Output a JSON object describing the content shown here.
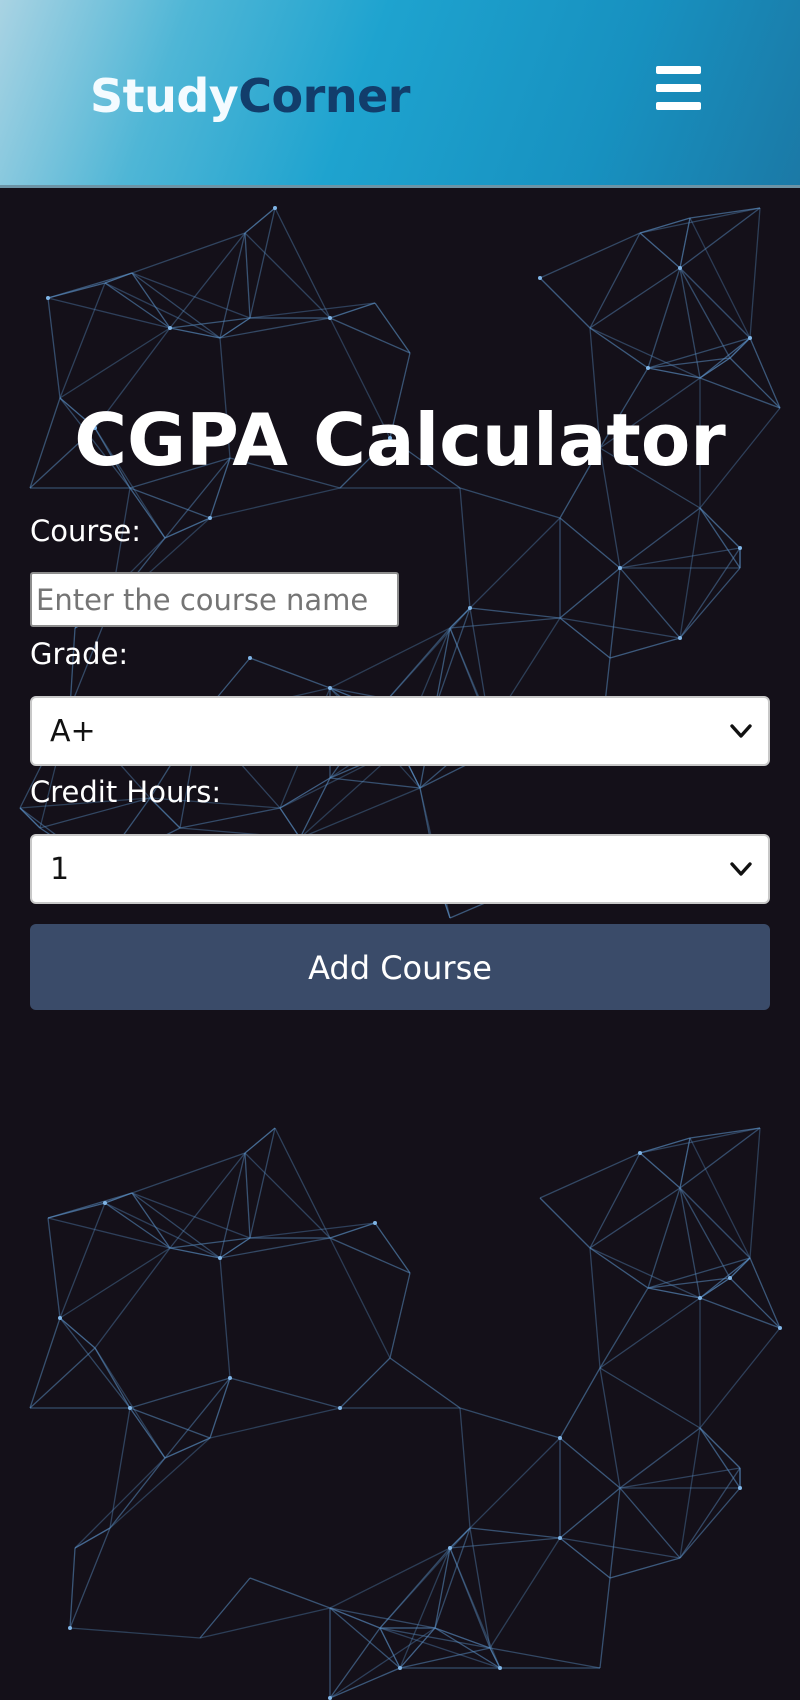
{
  "header": {
    "brand_part1": "Study",
    "brand_part2": "Corner",
    "menu_icon": "hamburger-menu-icon"
  },
  "main": {
    "title": "CGPA Calculator",
    "course_label": "Course:",
    "course_placeholder": "Enter the course name",
    "course_value": "",
    "grade_label": "Grade:",
    "grade_selected": "A+",
    "credit_label": "Credit Hours:",
    "credit_selected": "1",
    "add_button": "Add Course"
  },
  "colors": {
    "background": "#141019",
    "header_gradient_start": "#a9d3e3",
    "header_gradient_end": "#1b79a6",
    "brand_accent": "#123d6b",
    "button": "#3a4b69",
    "network_lines": "#5a8fc4"
  }
}
